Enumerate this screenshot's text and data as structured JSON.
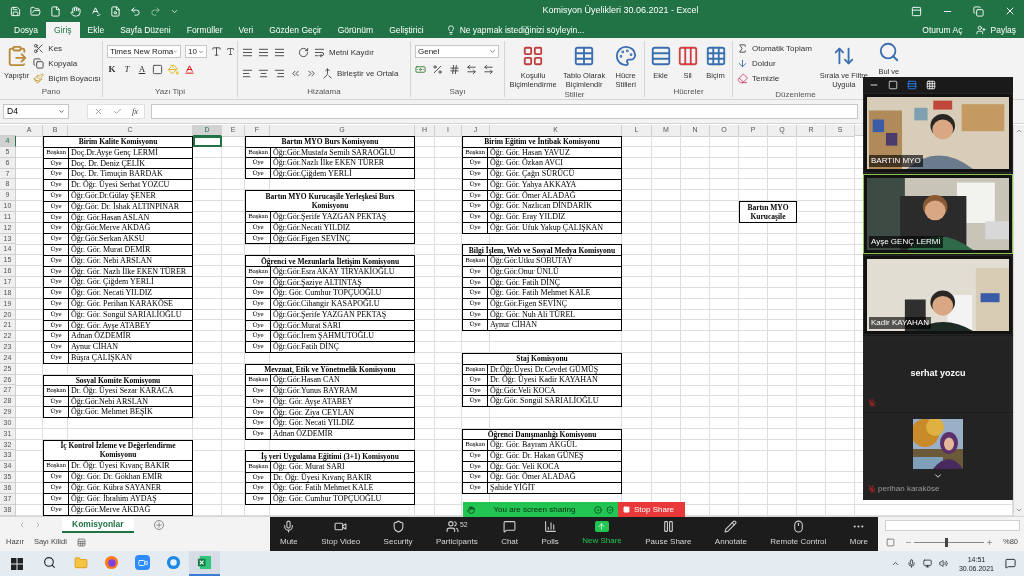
{
  "title_bar": {
    "title": "Komisyon Üyelikleri 30.06.2021 - Excel"
  },
  "ribbon_tabs": [
    {
      "label": "Dosya",
      "selected": false
    },
    {
      "label": "Giriş",
      "selected": true
    },
    {
      "label": "Ekle",
      "selected": false
    },
    {
      "label": "Sayfa Düzeni",
      "selected": false
    },
    {
      "label": "Formüller",
      "selected": false
    },
    {
      "label": "Veri",
      "selected": false
    },
    {
      "label": "Gözden Geçir",
      "selected": false
    },
    {
      "label": "Görünüm",
      "selected": false
    },
    {
      "label": "Geliştirici",
      "selected": false
    }
  ],
  "tell_me": {
    "placeholder": "Ne yapmak istediğinizi söyleyin..."
  },
  "account": {
    "sign_in": "Oturum Aç",
    "share": "Paylaş"
  },
  "ribbon": {
    "clipboard": {
      "label": "Pano",
      "paste": "Yapıştır",
      "commands": [
        "Kes",
        "Kopyala",
        "Biçim Boyacısı"
      ]
    },
    "font": {
      "label": "Yazı Tipi",
      "font_name": "Times New Roma",
      "font_size": "10",
      "format_buttons": [
        "K",
        "T",
        "A"
      ]
    },
    "alignment": {
      "label": "Hizalama",
      "commands": [
        "Metni Kaydır",
        "Birleştir ve Ortala"
      ]
    },
    "number": {
      "label": "Sayı",
      "format": "Genel"
    },
    "styles": {
      "label": "Stiller",
      "commands": [
        "Koşullu Biçimlendirme",
        "Tablo Olarak Biçimlendir",
        "Hücre Stilleri"
      ]
    },
    "cells": {
      "label": "Hücreler",
      "commands": [
        "Ekle",
        "Sil",
        "Biçim"
      ]
    },
    "editing": {
      "label": "Düzenleme",
      "commands": [
        "Otomatik Toplam",
        "Doldur",
        "Temizle"
      ],
      "large_commands": [
        "Sırala ve Filtre Uygula",
        "Bul ve"
      ]
    }
  },
  "formula_bar": {
    "name_box": "D4",
    "function_label": "fx"
  },
  "columns": [
    {
      "letter": "A",
      "selected": false
    },
    {
      "letter": "B",
      "selected": false
    },
    {
      "letter": "C",
      "selected": false
    },
    {
      "letter": "D",
      "selected": true
    },
    {
      "letter": "E",
      "selected": false
    },
    {
      "letter": "F",
      "selected": false
    },
    {
      "letter": "G",
      "selected": false
    },
    {
      "letter": "H",
      "selected": false
    },
    {
      "letter": "I",
      "selected": false
    },
    {
      "letter": "J",
      "selected": false
    },
    {
      "letter": "K",
      "selected": false
    },
    {
      "letter": "L",
      "selected": false
    },
    {
      "letter": "M",
      "selected": false
    },
    {
      "letter": "N",
      "selected": false
    },
    {
      "letter": "O",
      "selected": false
    },
    {
      "letter": "P",
      "selected": false
    },
    {
      "letter": "Q",
      "selected": false
    },
    {
      "letter": "R",
      "selected": false
    },
    {
      "letter": "S",
      "selected": false
    }
  ],
  "rows": [
    {
      "number": "4",
      "selected": true
    },
    {
      "number": "5",
      "selected": false
    },
    {
      "number": "6",
      "selected": false
    },
    {
      "number": "7",
      "selected": false
    },
    {
      "number": "8",
      "selected": false
    },
    {
      "number": "9",
      "selected": false
    },
    {
      "number": "10",
      "selected": false
    },
    {
      "number": "11",
      "selected": false
    },
    {
      "number": "12",
      "selected": false
    },
    {
      "number": "13",
      "selected": false
    },
    {
      "number": "14",
      "selected": false
    },
    {
      "number": "15",
      "selected": false
    },
    {
      "number": "16",
      "selected": false
    },
    {
      "number": "17",
      "selected": false
    },
    {
      "number": "18",
      "selected": false
    },
    {
      "number": "19",
      "selected": false
    },
    {
      "number": "20",
      "selected": false
    },
    {
      "number": "21",
      "selected": false
    },
    {
      "number": "22",
      "selected": false
    },
    {
      "number": "23",
      "selected": false
    },
    {
      "number": "24",
      "selected": false
    },
    {
      "number": "25",
      "selected": false
    },
    {
      "number": "26",
      "selected": false
    },
    {
      "number": "27",
      "selected": false
    },
    {
      "number": "28",
      "selected": false
    },
    {
      "number": "29",
      "selected": false
    },
    {
      "number": "30",
      "selected": false
    },
    {
      "number": "31",
      "selected": false
    },
    {
      "number": "32",
      "selected": false
    },
    {
      "number": "33",
      "selected": false
    },
    {
      "number": "34",
      "selected": false
    },
    {
      "number": "35",
      "selected": false
    },
    {
      "number": "36",
      "selected": false
    },
    {
      "number": "37",
      "selected": false
    },
    {
      "number": "38",
      "selected": false
    }
  ],
  "committee_columns": [
    [
      {
        "title": "Birim Kalite Komisyonu",
        "members": [
          {
            "role": "Başkan",
            "name": "Doç.Dr.Ayşe Genç LERMİ"
          },
          {
            "role": "Üye",
            "name": "Doç. Dr. Deniz ÇELİK"
          },
          {
            "role": "Üye",
            "name": "Doç. Dr. Timuçin BARDAK"
          },
          {
            "role": "Üye",
            "name": "Dr. Öğr. Üyesi Serhat YOZCU"
          },
          {
            "role": "Üye",
            "name": "Öğr.Gör.Dr.Gülay ŞENER"
          },
          {
            "role": "Üye",
            "name": "Öğr.Gör. Dr. İshak ALTINPINAR"
          },
          {
            "role": "Üye",
            "name": "Öğr. Gör.Hasan ASLAN"
          },
          {
            "role": "Üye",
            "name": "Öğr.Gör.Merve AKDAĞ"
          },
          {
            "role": "Üye",
            "name": "Öğr.Gör.Serkan AKSU"
          },
          {
            "role": "Üye",
            "name": "Öğr. Gör. Murat DEMİR"
          },
          {
            "role": "Üye",
            "name": "Öğr. Gör. Nebi ARSLAN"
          },
          {
            "role": "Üye",
            "name": "Öğr. Gör. Nazlı İlke EKEN TÜRER"
          },
          {
            "role": "Üye",
            "name": "Öğr. Gör. Çiğdem YERLİ"
          },
          {
            "role": "Üye",
            "name": "Öğr. Gör. Necati YILDIZ"
          },
          {
            "role": "Üye",
            "name": "Öğr. Gör. Perihan KARAKÖSE"
          },
          {
            "role": "Üye",
            "name": "Öğr. Gör. Songül SARIALİOĞLU"
          },
          {
            "role": "Üye",
            "name": "Öğr. Gör. Ayşe ATABEY"
          },
          {
            "role": "Üye",
            "name": "Adnan ÖZDEMİR"
          },
          {
            "role": "Üye",
            "name": "Aynur CİHAN"
          },
          {
            "role": "Üye",
            "name": "Büşra ÇALIŞKAN"
          }
        ]
      },
      {
        "title": "Sosyal Komite Komisyonu",
        "members": [
          {
            "role": "Başkan",
            "name": "Dr. Öğr. Üyesi Sezar KARACA"
          },
          {
            "role": "Üye",
            "name": "Öğr.Gör.Nebi ARSLAN"
          },
          {
            "role": "Üye",
            "name": "Öğr.Gör. Mehmet BEŞİK"
          }
        ]
      },
      {
        "title": "İç Kontrol İzleme ve Değerlendirme Komisyonu",
        "members": [
          {
            "role": "Başkan",
            "name": "Dr. Öğr. Üyesi Kıvanç BAKIR"
          },
          {
            "role": "Üye",
            "name": "Öğr. Gör. Dr. Gökhan EMİR"
          },
          {
            "role": "Üye",
            "name": "Öğr. Gör. Kübra SAYANER"
          },
          {
            "role": "Üye",
            "name": "Öğr. Gör. İbrahim AYDAŞ"
          },
          {
            "role": "Üye",
            "name": "Öğr.Gör.Merve AKDAĞ"
          }
        ]
      }
    ],
    [
      {
        "title": "Bartın MYO Burs Komisyonu",
        "members": [
          {
            "role": "Başkan",
            "name": "Öğr.Gör.Mustafa Semih SARAOĞLU"
          },
          {
            "role": "Üye",
            "name": "Öğr.Gör.Nazlı İlke EKEN TÜRER"
          },
          {
            "role": "Üye",
            "name": "Öğr.Gör.Çiğdem YERLİ"
          }
        ]
      },
      {
        "title": "Bartın MYO Kurucaşile Yerleşkesi Burs Komisyonu",
        "members": [
          {
            "role": "Başkan",
            "name": "Öğr.Gör.Şerife YAZGAN PEKTAŞ"
          },
          {
            "role": "Üye",
            "name": "Öğr.Gör.Necati YILDIZ"
          },
          {
            "role": "Üye",
            "name": "Öğr.Gör.Figen SEVİNÇ"
          }
        ]
      },
      {
        "title": "Öğrenci ve Mezunlarla İletişim Komisyonu",
        "members": [
          {
            "role": "Başkan",
            "name": "Öğr.Gör.Esra AKAY TİRYAKİOĞLU"
          },
          {
            "role": "Üye",
            "name": "Öğr.Gör.Şaziye ALTINTAŞ"
          },
          {
            "role": "Üye",
            "name": "Öğr. Gör. Cumhur TOPÇUOĞLU"
          },
          {
            "role": "Üye",
            "name": "Öğr.Gör.Cihangir KASAPOĞLU"
          },
          {
            "role": "Üye",
            "name": "Öğr.Gör.Şerife YAZGAN PEKTAŞ"
          },
          {
            "role": "Üye",
            "name": "Öğr.Gör.Murat SARI"
          },
          {
            "role": "Üye",
            "name": "Öğr.Gör.İrem ŞAHMUTOĞLU"
          },
          {
            "role": "Üye",
            "name": "Öğr.Gör.Fatih DİNÇ"
          }
        ]
      },
      {
        "title": "Mevzuat, Etik ve Yönetmelik Komisyonu",
        "members": [
          {
            "role": "Başkan",
            "name": "Öğr.Gör.Hasan CAN"
          },
          {
            "role": "Üye",
            "name": "Öğr.Gör.Yunus BAYRAM"
          },
          {
            "role": "Üye",
            "name": "Öğr. Gör. Ayşe ATABEY"
          },
          {
            "role": "Üye",
            "name": "Öğr. Gör. Ziya CEYLAN"
          },
          {
            "role": "Üye",
            "name": "Öğr. Gör. Necati YILDIZ"
          },
          {
            "role": "Üye",
            "name": "Adnan ÖZDEMİR"
          }
        ]
      },
      {
        "title": "İş yeri Uygulama Eğitimi (3+1) Komisyonu",
        "members": [
          {
            "role": "Başkan",
            "name": "Öğr. Gör. Murat SARI"
          },
          {
            "role": "Üye",
            "name": "Dr. Öğr. Üyesi Kıvanç BAKIR"
          },
          {
            "role": "Üye",
            "name": "Öğr. Gör. Fatih Mehmet KALE"
          },
          {
            "role": "Üye",
            "name": "Öğr. Gör. Cumhur TOPÇUOĞLU"
          }
        ]
      }
    ],
    [
      {
        "title": "Birim Eğitim ve İntibak Komisyonu",
        "members": [
          {
            "role": "Başkan",
            "name": "Öğr. Gör. Hasan YAVUZ"
          },
          {
            "role": "Üye",
            "name": "Öğr. Gör. Özkan AVCI"
          },
          {
            "role": "Üye",
            "name": "Öğr. Gör. Çağrı SÜRÜCÜ"
          },
          {
            "role": "Üye",
            "name": "Öğr. Gör. Yahya AKKAYA"
          },
          {
            "role": "Üye",
            "name": "Öğr. Gör. Ömer ALADAĞ"
          },
          {
            "role": "Üye",
            "name": "Öğr. Gör. Nazlıcan DİNDARİK"
          },
          {
            "role": "Üye",
            "name": "Öğr. Gör. Eray YILDIZ"
          },
          {
            "role": "Üye",
            "name": "Öğr. Gör. Ufuk Yakup ÇALIŞKAN"
          }
        ]
      },
      {
        "title": "Bilgi İşlem, Web ve Sosyal Medya Komisyonu",
        "members": [
          {
            "role": "Başkan",
            "name": "Öğr.Gör.Utku SOBUTAY"
          },
          {
            "role": "Üye",
            "name": "Öğr.Gör.Onur ÜNLÜ"
          },
          {
            "role": "Üye",
            "name": "Öğr. Gör. Fatih DİNÇ"
          },
          {
            "role": "Üye",
            "name": "Öğr. Gör. Fatih Mehmet KALE"
          },
          {
            "role": "Üye",
            "name": "Öğr.Gör.Figen SEVİNÇ"
          },
          {
            "role": "Üye",
            "name": "Öğr. Gör. Nuh Ali TÜREL"
          },
          {
            "role": "Üye",
            "name": "Aynur CİHAN"
          }
        ]
      },
      {
        "title": "Staj Komisyonu",
        "members": [
          {
            "role": "Başkan",
            "name": "Dr.Öğr.Üyesi Dr.Cevdet GÜMÜŞ"
          },
          {
            "role": "Üye",
            "name": "Dr. Öğr. Üyesi Kadir KAYAHAN"
          },
          {
            "role": "Üye",
            "name": "Öğr.Gör.Veli KOCA"
          },
          {
            "role": "Üye",
            "name": "Öğr.Gör. Songül SARIALİOĞLU"
          }
        ]
      },
      {
        "title": "Öğrenci Danışmanlığı Komisyonu",
        "members": [
          {
            "role": "Başkan",
            "name": "Öğr. Gör. Bayram AKGÜL"
          },
          {
            "role": "Üye",
            "name": "Öğr. Gör. Dr. Hakan GÜNEŞ"
          },
          {
            "role": "Üye",
            "name": "Öğr. Gör. Veli KOCA"
          },
          {
            "role": "Üye",
            "name": "Öğr. Gör. Ömer ALADAĞ"
          },
          {
            "role": "Üye",
            "name": "Şahide YİĞİT"
          }
        ]
      }
    ]
  ],
  "note_box": {
    "text": "Bartın MYO Kurucaşile"
  },
  "sheet_tabs": [
    {
      "label": "Komisyonlar",
      "selected": true
    }
  ],
  "status_bar": {
    "items": [
      "Hazır",
      "Sayı Kilidi"
    ],
    "zoom": "%80",
    "zoom_slider": {
      "level": 0.45
    }
  },
  "zoom_meeting": {
    "participants": [
      {
        "name": "BARTIN MYO",
        "kind": "video",
        "active_speaker": false,
        "muted": false
      },
      {
        "name": "Ayşe GENÇ LERMİ",
        "kind": "video",
        "active_speaker": true,
        "muted": false
      },
      {
        "name": "Kadir KAYAHAN",
        "kind": "video",
        "active_speaker": false,
        "muted": false
      },
      {
        "name": "serhat yozcu",
        "kind": "name",
        "active_speaker": false,
        "muted": true
      },
      {
        "name": "perihan karaköse",
        "kind": "avatar",
        "active_speaker": false,
        "muted": true
      }
    ],
    "sharing_banner": {
      "text": "You are screen sharing",
      "stop": "Stop Share"
    },
    "toolbar": [
      {
        "kind": "mute",
        "label": "Mute"
      },
      {
        "kind": "video",
        "label": "Stop Video"
      },
      {
        "kind": "security",
        "label": "Security"
      },
      {
        "kind": "participants",
        "label": "Participants",
        "count": "52"
      },
      {
        "kind": "chat",
        "label": "Chat"
      },
      {
        "kind": "polls",
        "label": "Polls"
      },
      {
        "kind": "new_share",
        "label": "New Share"
      },
      {
        "kind": "pause_share",
        "label": "Pause Share"
      },
      {
        "kind": "annotate",
        "label": "Annotate"
      },
      {
        "kind": "remote_control",
        "label": "Remote Control"
      },
      {
        "kind": "more",
        "label": "More"
      }
    ]
  },
  "taskbar": {
    "apps": [
      {
        "kind": "search",
        "selected": false
      },
      {
        "kind": "files",
        "selected": false
      },
      {
        "kind": "browser",
        "selected": false
      },
      {
        "kind": "zoom",
        "selected": false
      },
      {
        "kind": "chat",
        "selected": false
      },
      {
        "kind": "excel",
        "selected": true
      }
    ],
    "clock": {
      "time": "14:51",
      "date": "30.06.2021"
    }
  }
}
